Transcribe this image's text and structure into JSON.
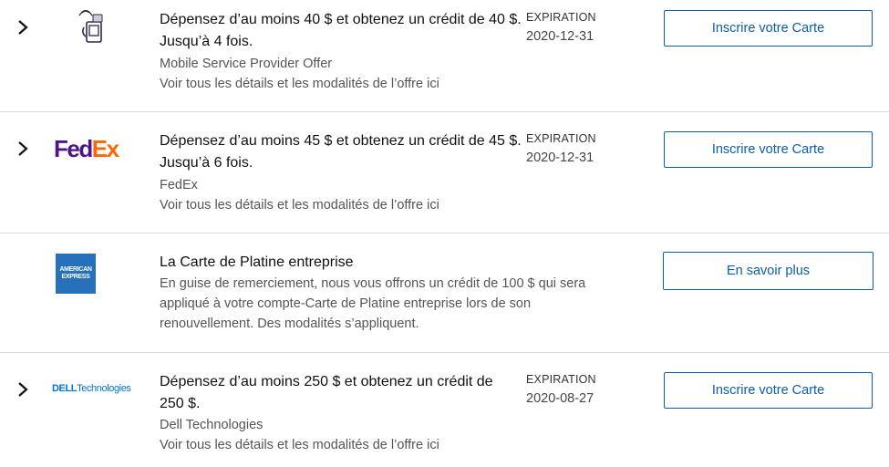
{
  "offers": [
    {
      "title": "Dépensez d’au moins 40 $ et obtenez un crédit de 40 $. Jusqu’à 4 fois.",
      "merchant": "Mobile Service Provider Offer",
      "details_link": "Voir tous les détails et les modalités de l’offre ici",
      "expiration_label": "EXPIRATION",
      "expiration_date": "2020-12-31",
      "button": "Inscrire votre Carte",
      "icon": "mobile-payment-icon"
    },
    {
      "title": "Dépensez d’au moins 45 $ et obtenez un crédit de 45 $. Jusqu’à 6 fois.",
      "merchant": "FedEx",
      "details_link": "Voir tous les détails et les modalités de l’offre ici",
      "expiration_label": "EXPIRATION",
      "expiration_date": "2020-12-31",
      "button": "Inscrire votre Carte",
      "logo_text": "FedEx",
      "logo_colors": {
        "fed": "#4d148c",
        "ex": "#ff6600"
      }
    },
    {
      "title": "La Carte de Platine entreprise",
      "description": "En guise de remerciement, nous vous offrons un crédit de 100 $ qui sera appliqué à votre compte-Carte de Platine entreprise lors de son renouvellement. Des modalités s’appliquent.",
      "button": "En savoir plus",
      "logo_text_top": "AMERICAN",
      "logo_text_bottom": "EXPRESS",
      "logo_color": "#2671b9"
    },
    {
      "title": "Dépensez d’au moins 250 $ et obtenez un crédit de 250 $.",
      "merchant": "Dell Technologies",
      "details_link": "Voir tous les détails et les modalités de l’offre ici",
      "expiration_label": "EXPIRATION",
      "expiration_date": "2020-08-27",
      "button": "Inscrire votre Carte",
      "logo_text": "DELLTechnologies",
      "logo_color": "#0076ce"
    }
  ],
  "colors": {
    "accent": "#0b5ea7",
    "divider": "#d9dce0"
  }
}
